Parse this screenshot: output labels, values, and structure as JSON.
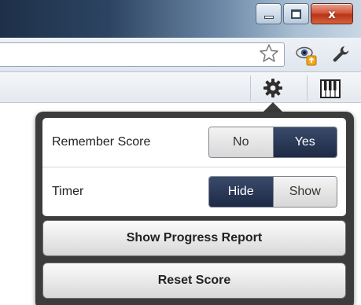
{
  "window": {
    "close_glyph": "x",
    "controls": [
      "minimize-icon",
      "maximize-icon",
      "close-icon"
    ]
  },
  "toolbar": {
    "icons": [
      "star-icon",
      "eye-extension-icon",
      "wrench-icon"
    ]
  },
  "extensions": {
    "icons": [
      "gear-icon",
      "piano-keys-icon"
    ]
  },
  "popup": {
    "settings": [
      {
        "label": "Remember Score",
        "options": [
          "No",
          "Yes"
        ],
        "selected": "Yes"
      },
      {
        "label": "Timer",
        "options": [
          "Hide",
          "Show"
        ],
        "selected": "Hide"
      }
    ],
    "actions": {
      "progress_label": "Show Progress Report",
      "reset_label": "Reset Score"
    }
  },
  "colors": {
    "selected_segment": "#1d2a45",
    "popup_frame": "#3c3c3c",
    "close_button": "#c8432a"
  }
}
